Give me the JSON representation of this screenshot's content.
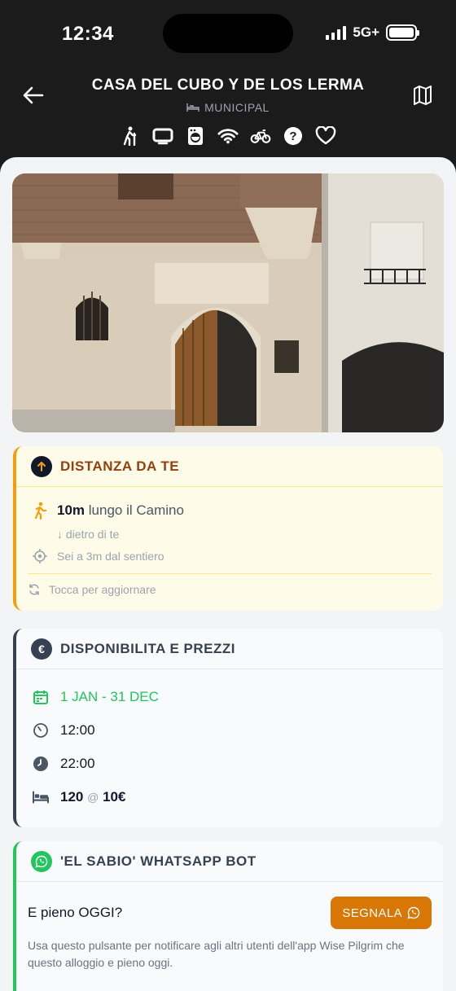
{
  "status": {
    "time": "12:34",
    "network": "5G+"
  },
  "header": {
    "title": "CASA DEL CUBO Y DE LOS LERMA",
    "subtitle": "MUNICIPAL",
    "amenities": [
      "pilgrim-icon",
      "tv-icon",
      "washer-icon",
      "wifi-icon",
      "bicycle-icon",
      "help-icon",
      "heart-icon"
    ]
  },
  "photo": {
    "alt": ""
  },
  "distance": {
    "heading": "DISTANZA DA TE",
    "distance_value": "10m",
    "distance_text": "lungo il Camino",
    "direction": "↓ dietro di te",
    "offset": "Sei a 3m dal sentiero",
    "refresh": "Tocca per aggiornare"
  },
  "availability": {
    "heading": "DISPONIBILITA E PREZZI",
    "dates": "1 JAN - 31 DEC",
    "open_time": "12:00",
    "close_time": "22:00",
    "beds": "120",
    "at": "@",
    "price": "10€"
  },
  "whatsapp": {
    "heading": "'EL SABIO' WHATSAPP BOT",
    "question": "E pieno OGGI?",
    "button_label": "SEGNALA",
    "description": "Usa questo pulsante per notificare agli altri utenti dell'app Wise Pilgrim che questo alloggio e pieno oggi."
  },
  "colors": {
    "accent_amber": "#f59e0b",
    "button_orange": "#d97706",
    "green": "#22c55e",
    "dark": "#374151"
  }
}
